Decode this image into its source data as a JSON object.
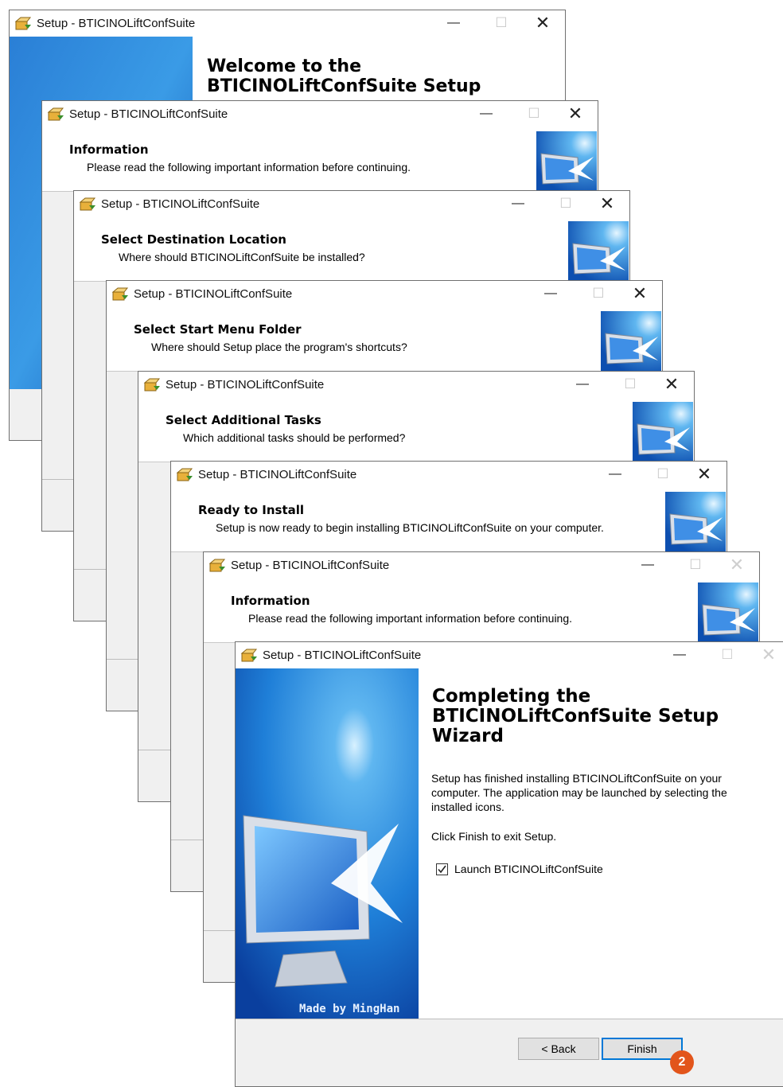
{
  "window_title": "Setup - BTICINOLiftConfSuite",
  "controls": {
    "minimize": "—",
    "maximize": "☐",
    "close": "✕"
  },
  "colors": {
    "title_bg": "#ffffff",
    "body_bg": "#f0f0f0",
    "accent": "#0078d7",
    "badge": "#e2551b"
  },
  "welcome": {
    "title_line1": "Welcome to the",
    "title_line2": "BTICINOLiftConfSuite Setup"
  },
  "pages": [
    {
      "title": "Information",
      "subtitle": "Please read the following important information before continuing."
    },
    {
      "title": "Select Destination Location",
      "subtitle": "Where should BTICINOLiftConfSuite be installed?"
    },
    {
      "title": "Select Start Menu Folder",
      "subtitle": "Where should Setup place the program's shortcuts?"
    },
    {
      "title": "Select Additional Tasks",
      "subtitle": "Which additional tasks should be performed?"
    },
    {
      "title": "Ready to Install",
      "subtitle": "Setup is now ready to begin installing BTICINOLiftConfSuite on your computer."
    },
    {
      "title": "Information",
      "subtitle": "Please read the following important information before continuing."
    }
  ],
  "finish": {
    "title_line1": "Completing the",
    "title_line2": "BTICINOLiftConfSuite Setup",
    "title_line3": "Wizard",
    "body": "Setup has finished installing BTICINOLiftConfSuite on your computer. The application may be launched by selecting the installed icons.",
    "exit_text": "Click Finish to exit Setup.",
    "launch_label": "Launch BTICINOLiftConfSuite",
    "launch_checked": true,
    "watermark": "Made by MingHan",
    "back_label": "< Back",
    "finish_label": "Finish",
    "step_badge": "2"
  },
  "icons": [
    "installer-box-icon",
    "monitor-arrow-graphic",
    "checkmark-icon"
  ]
}
